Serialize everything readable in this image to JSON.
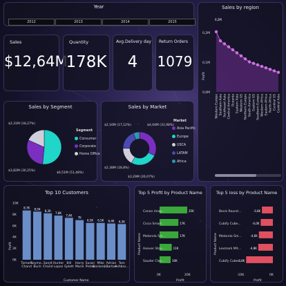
{
  "year_slicer": {
    "title": "Year",
    "years": [
      "2012",
      "2013",
      "2014",
      "2015"
    ]
  },
  "kpis": {
    "sales": {
      "label": "Sales",
      "value": "$12,64M"
    },
    "quantity": {
      "label": "Quantity",
      "value": "178K"
    },
    "delivery": {
      "label": "Avg.Delivery day",
      "value": "4"
    },
    "returns": {
      "label": "Return Orders",
      "value": "1079"
    }
  },
  "colors": {
    "accent": "#d070e0",
    "consumer": "#1fd6c8",
    "corporate": "#7a2fc0",
    "home_office": "#cfcfdc",
    "profit_bar": "#3aa83a",
    "loss_bar": "#e05060",
    "customer_bar": "#6a8ec8"
  },
  "chart_data": [
    {
      "id": "sales_by_region",
      "type": "line",
      "title": "Sales by region",
      "ylabel": "Profit",
      "yticks": [
        "0,2M",
        "0,1M",
        "0,0M"
      ],
      "ylim": [
        0,
        0.2
      ],
      "top_label": "0,2M",
      "categories": [
        "Western Europe",
        "Southern Asia",
        "Southeast Asia",
        "Central America",
        "Oceania",
        "Eastern Asia",
        "Western US",
        "Northern Europe",
        "South America",
        "Eastern US",
        "Southern Europe",
        "Western Africa",
        "Eastern Africa",
        "North Africa",
        "Central US",
        "Central Asia"
      ],
      "values": [
        0.2,
        0.17,
        0.16,
        0.15,
        0.14,
        0.13,
        0.12,
        0.11,
        0.1,
        0.095,
        0.09,
        0.085,
        0.08,
        0.075,
        0.07,
        0.065
      ]
    },
    {
      "id": "sales_by_segment",
      "type": "pie",
      "title": "Sales by Segment",
      "legend_title": "Segment",
      "legend": [
        "Consumer",
        "Corporate",
        "Home Office"
      ],
      "slices": [
        {
          "name": "Consumer",
          "value": 51.48,
          "label": "$6,51M (51,48%)"
        },
        {
          "name": "Corporate",
          "value": 30.25,
          "label": "$3,82M (30,25%)"
        },
        {
          "name": "Home Office",
          "value": 18.27,
          "label": "$2,31M (18,27%)"
        }
      ]
    },
    {
      "id": "sales_by_market",
      "type": "pie",
      "title": "Sales by Market",
      "legend_title": "Market",
      "legend": [
        "Asia Pacific",
        "Europe",
        "USCA",
        "LATAM",
        "Africa"
      ],
      "slices": [
        {
          "name": "Asia Pacific",
          "value": 31.98,
          "label": "$4,04M (31,98%)"
        },
        {
          "name": "Europe",
          "value": 26.07,
          "label": "$3,29M (26,07%)"
        },
        {
          "name": "USCA",
          "value": 17.12,
          "label": "$2,16M (17,12%)"
        },
        {
          "name": "LATAM",
          "value": 18.8,
          "label": "$2,38M (18,8%)"
        },
        {
          "name": "Africa",
          "value": 6.03,
          "label": ""
        }
      ]
    },
    {
      "id": "top10_customers",
      "type": "bar",
      "title": "Top 10 Customers",
      "ylabel": "Profit",
      "xlabel": "Customer Name",
      "yticks": [
        "10K",
        "8K",
        "6K",
        "4K",
        "2K",
        "0K"
      ],
      "ylim": [
        0,
        10
      ],
      "categories": [
        "Tamara Chand",
        "Raymo... Buch",
        "Sanjit Chand",
        "Hunter Lopez",
        "Bill Eplett",
        "Harry Marie",
        "Susan Pistek",
        "Mike Gockenb...",
        "Adrian Barton",
        "Tom Ashbro..."
      ],
      "values": [
        8.7,
        8.5,
        8.2,
        7.8,
        7.4,
        7.0,
        6.5,
        6.5,
        6.4,
        6.3
      ],
      "labels": [
        "8,7K",
        "8,5K",
        "8,2K",
        "7,8K",
        "7,4K",
        "7K",
        "6,5K",
        "6,5K",
        "6,4K",
        "6,3K"
      ]
    },
    {
      "id": "top5_profit",
      "type": "bar",
      "title": "Top 5 Profit by Product Name",
      "ylabel": "Product Name",
      "xlabel": "Profit",
      "xticks": [
        "0K",
        "20K"
      ],
      "categories": [
        "Canon imag...",
        "Cisco Smart...",
        "Motorola Sm...",
        "Hoover Stov...",
        "Sauder Clas..."
      ],
      "values": [
        25,
        17,
        17,
        11,
        10
      ],
      "labels": [
        "25K",
        "17K",
        "17K",
        "11K",
        "10K"
      ]
    },
    {
      "id": "top5_loss",
      "type": "bar",
      "title": "Top 5 loss by Product Name",
      "ylabel": "Product Name",
      "xlabel": "Profit",
      "xticks": [
        "-10K",
        "0K"
      ],
      "categories": [
        "Bevis Round...",
        "Cubify Cube...",
        "Motorola Sm...",
        "Lexmark MX...",
        "Cubify Cube..."
      ],
      "values": [
        -3.6,
        -4.0,
        -4.6,
        -4.8,
        -8.8
      ],
      "labels": [
        "-3,6K",
        "-4,0K",
        "-4,6K",
        "-4,8K",
        "-8,8K"
      ]
    }
  ]
}
